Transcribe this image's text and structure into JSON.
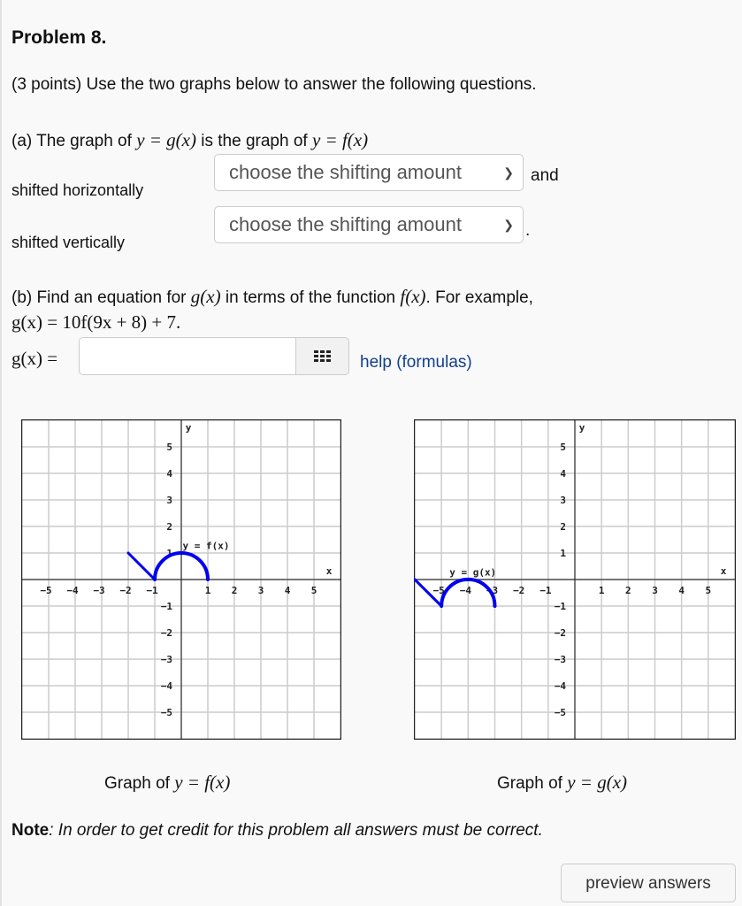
{
  "problem": {
    "title": "Problem 8.",
    "intro": "(3 points) Use the two graphs below to answer the following questions."
  },
  "part_a": {
    "prefix": "(a) The graph of ",
    "g_expr": "y = g(x)",
    "middle": " is the graph of ",
    "f_expr": "y = f(x)",
    "horizontal_label": "shifted horizontally",
    "vertical_label": "shifted vertically",
    "select_horizontal": "choose the shifting amount",
    "select_vertical": "choose the shifting amount",
    "and_text": "and",
    "period": "."
  },
  "part_b": {
    "line1_prefix": "(b) Find an equation for ",
    "line1_g": "g(x)",
    "line1_mid": " in terms of the function ",
    "line1_f": "f(x)",
    "line1_suffix": ". For example,",
    "example": "g(x) = 10f(9x + 8) + 7.",
    "answer_label": "g(x) =",
    "answer_value": "",
    "help_link": "help (formulas)"
  },
  "captions": {
    "left_prefix": "Graph of ",
    "left_expr": "y = f(x)",
    "right_prefix": "Graph of ",
    "right_expr": "y = g(x)"
  },
  "note": {
    "bold": "Note",
    "text": ": In order to get credit for this problem all answers must be correct."
  },
  "buttons": {
    "preview": "preview answers"
  },
  "colors": {
    "curve": "#0000ee",
    "grid": "#cccccc",
    "axis": "#333333",
    "link": "#123f8c"
  },
  "chart_data": [
    {
      "type": "line",
      "title": "Graph of y = f(x)",
      "curve_label": "y = f(x)",
      "xlabel": "x",
      "ylabel": "y",
      "xlim": [
        -6,
        6
      ],
      "ylim": [
        -6,
        6
      ],
      "grid": true,
      "x_ticks": [
        -5,
        -4,
        -3,
        -2,
        -1,
        1,
        2,
        3,
        4,
        5
      ],
      "y_ticks": [
        5,
        4,
        3,
        2,
        1,
        -1,
        -2,
        -3,
        -4,
        -5
      ],
      "segments": [
        {
          "kind": "line",
          "points": [
            [
              -2,
              1
            ],
            [
              -1,
              0
            ]
          ]
        },
        {
          "kind": "semicircle",
          "center": [
            0,
            0
          ],
          "radius": 1,
          "from": [
            -1,
            0
          ],
          "to": [
            1,
            0
          ]
        }
      ]
    },
    {
      "type": "line",
      "title": "Graph of y = g(x)",
      "curve_label": "y = g(x)",
      "xlabel": "x",
      "ylabel": "y",
      "xlim": [
        -6,
        6
      ],
      "ylim": [
        -6,
        6
      ],
      "grid": true,
      "x_ticks": [
        -5,
        -4,
        -3,
        -2,
        -1,
        1,
        2,
        3,
        4,
        5
      ],
      "y_ticks": [
        5,
        4,
        3,
        2,
        1,
        -1,
        -2,
        -3,
        -4,
        -5
      ],
      "segments": [
        {
          "kind": "line",
          "points": [
            [
              -6,
              0
            ],
            [
              -5,
              -1
            ]
          ]
        },
        {
          "kind": "semicircle",
          "center": [
            -4,
            -1
          ],
          "radius": 1,
          "from": [
            -5,
            -1
          ],
          "to": [
            -3,
            -1
          ]
        }
      ]
    }
  ]
}
